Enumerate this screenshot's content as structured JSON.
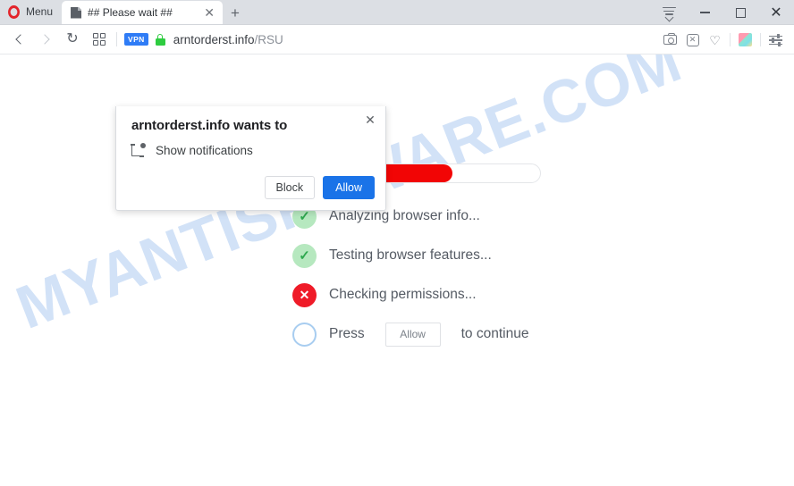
{
  "browser": {
    "menu_label": "Menu",
    "menu_icon": "opera-logo-icon",
    "tabs": [
      {
        "title": "## Please wait ##",
        "favicon": "page-document-icon",
        "close_glyph": "✕"
      }
    ],
    "new_tab_glyph": "+",
    "window_controls": {
      "tab_menu": "tab-list-icon",
      "minimize": "minimize-icon",
      "maximize": "maximize-icon",
      "close": "✕"
    },
    "navigation": {
      "back": "back-arrow-icon",
      "forward": "forward-arrow-icon",
      "reload_glyph": "↻",
      "speed_dial": "speed-dial-grid-icon"
    },
    "address": {
      "vpn_badge": "VPN",
      "lock_icon": "secure-padlock-icon",
      "url_host": "arntorderst.info",
      "url_path": "/RSU"
    },
    "toolbar_icons": [
      {
        "name": "snapshot-camera-icon",
        "glyph": ""
      },
      {
        "name": "ad-blocker-icon",
        "glyph": "✕"
      },
      {
        "name": "favorites-heart-icon",
        "glyph": "♡"
      },
      {
        "name": "workspaces-cube-icon",
        "glyph": ""
      },
      {
        "name": "easy-setup-sliders-icon",
        "glyph": ""
      }
    ]
  },
  "page": {
    "watermark": "MYANTISPYWARE.COM",
    "progress": {
      "label": "loading-progress",
      "percent": 64,
      "fill_color": "#f20505",
      "track_color": "#ffffff"
    },
    "status_steps": [
      {
        "state": "ok",
        "glyph": "✓",
        "text": "Analyzing browser info..."
      },
      {
        "state": "ok",
        "glyph": "✓",
        "text": "Testing browser features..."
      },
      {
        "state": "err",
        "glyph": "✕",
        "text": "Checking permissions..."
      },
      {
        "state": "idle",
        "glyph": "",
        "text_before": "Press",
        "chip": "Allow",
        "text_after": "to continue"
      }
    ]
  },
  "dialog": {
    "title": "arntorderst.info wants to",
    "close_glyph": "✕",
    "permission_icon": "show-notifications-icon",
    "permission_label": "Show notifications",
    "block_label": "Block",
    "allow_label": "Allow",
    "allow_color": "#1a73e8"
  }
}
